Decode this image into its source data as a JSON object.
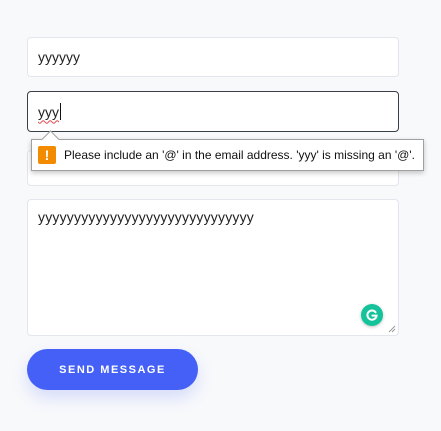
{
  "form": {
    "name_value": "yyyyyy",
    "email_value": "yyy",
    "hidden_value": "",
    "message_value": "yyyyyyyyyyyyyyyyyyyyyyyyyyyyyy",
    "submit_label": "SEND MESSAGE"
  },
  "validation_tooltip": {
    "icon": "warning-icon",
    "icon_glyph": "!",
    "message": "Please include an '@' in the email address. 'yyy' is missing an '@'."
  },
  "grammarly": {
    "icon": "grammarly-icon"
  },
  "colors": {
    "accent": "#4460f7",
    "warning": "#f28b00",
    "grammarly": "#15c39a",
    "background": "#f8f9fb"
  }
}
